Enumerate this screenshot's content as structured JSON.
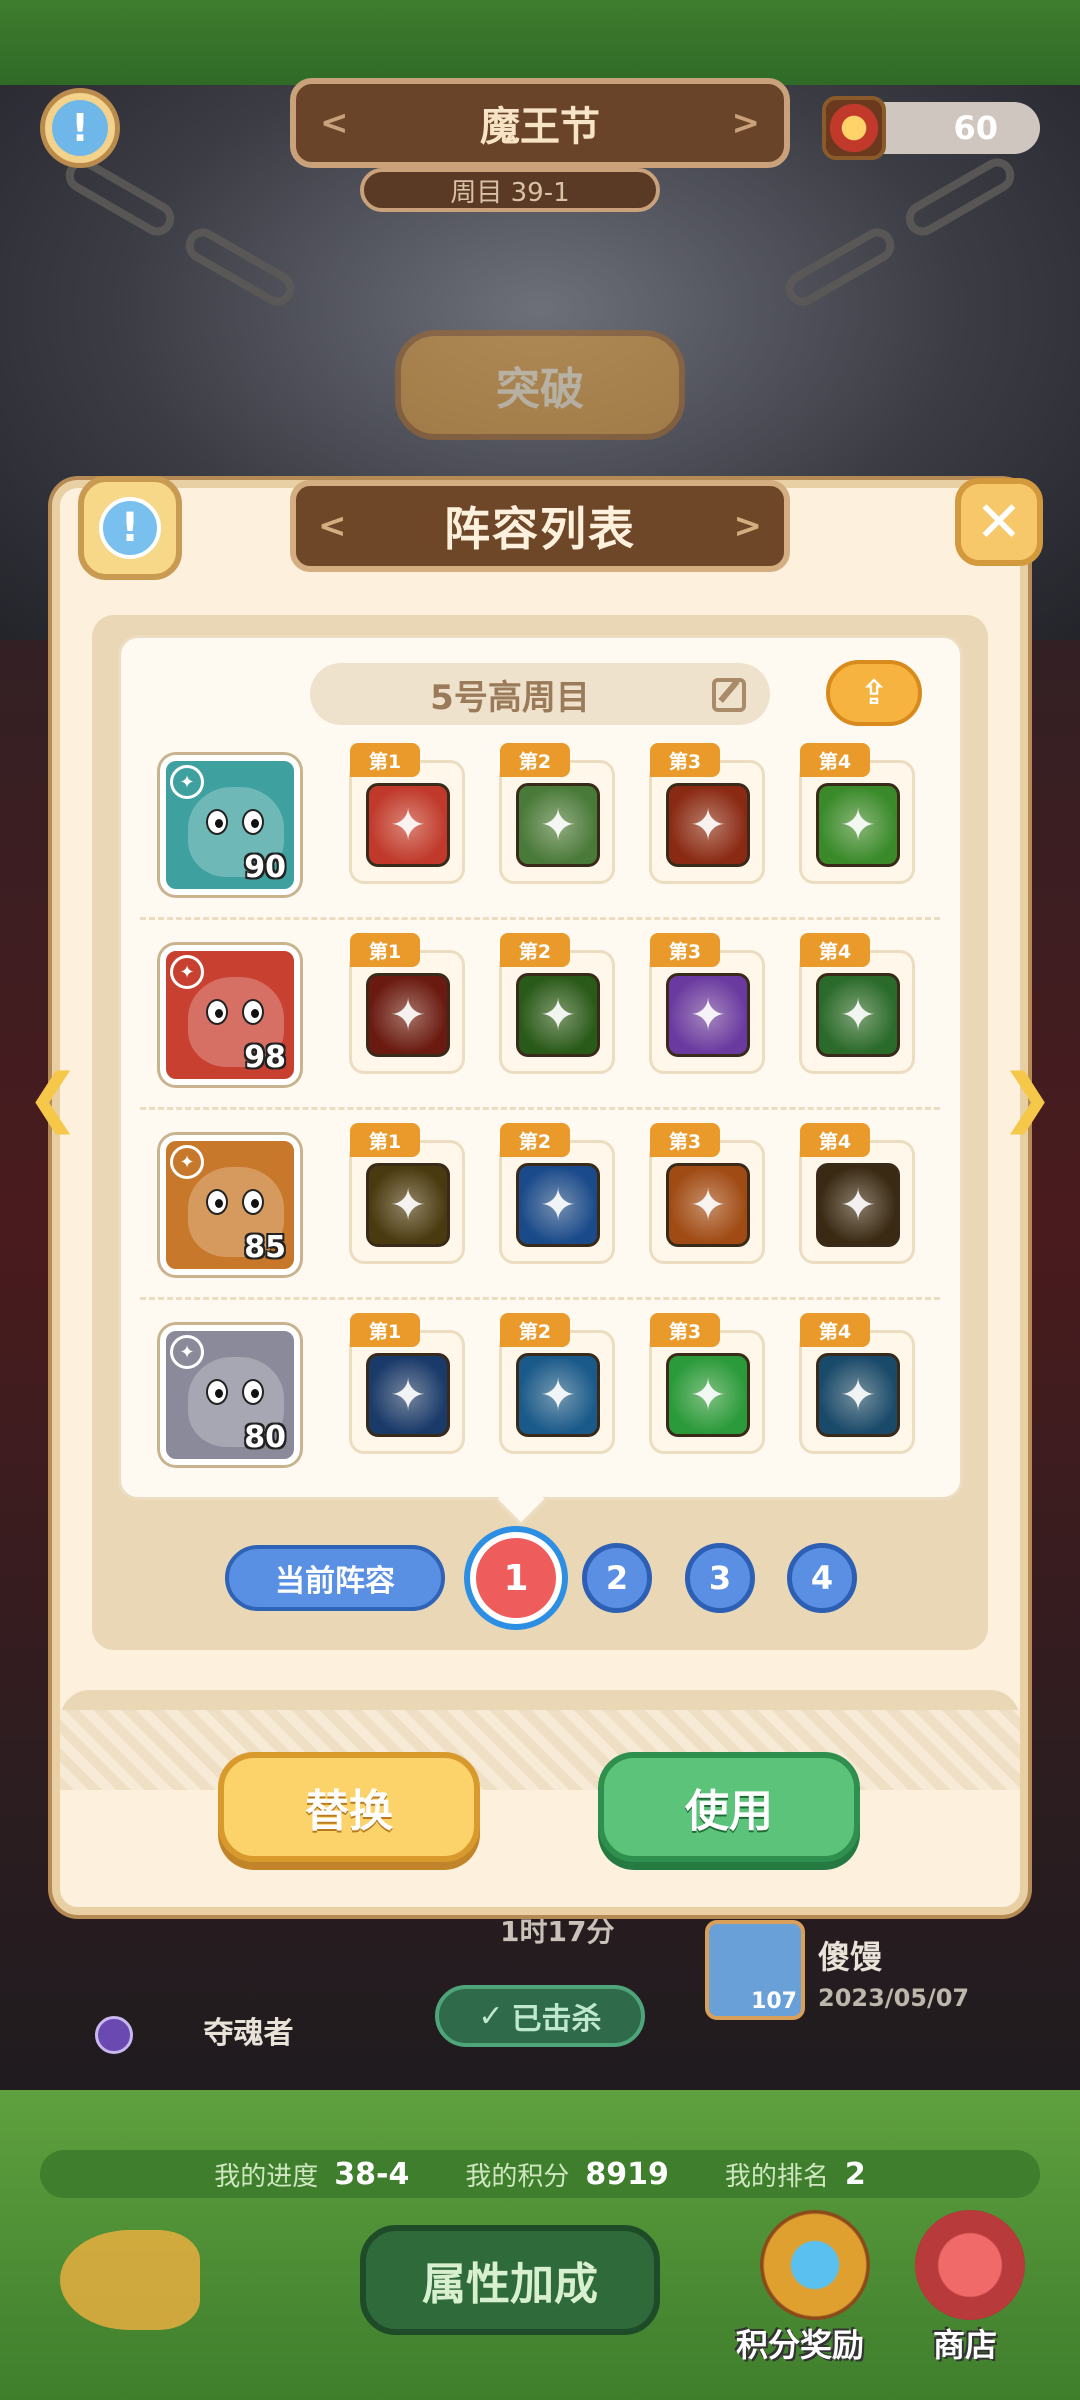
{
  "top_bar": {
    "event_title": "魔王节",
    "round_label": "周目 39-1",
    "currency_value": "60",
    "breakthrough_label": "突破"
  },
  "modal": {
    "title": "阵容列表",
    "lineup_name": "5号高周目",
    "rows": [
      {
        "hero_level": "90",
        "hero_color": "#3fa0a0",
        "skills": [
          {
            "tag": "第1",
            "color": "#c0392b",
            "icon": "axe-icon"
          },
          {
            "tag": "第2",
            "color": "#4a7a3a",
            "icon": "arrows-icon"
          },
          {
            "tag": "第3",
            "color": "#8a2a14",
            "icon": "demon-face-icon"
          },
          {
            "tag": "第4",
            "color": "#3a8a2a",
            "icon": "shield-star-icon"
          }
        ]
      },
      {
        "hero_level": "98",
        "hero_color": "#c84030",
        "skills": [
          {
            "tag": "第1",
            "color": "#6a1a10",
            "icon": "fire-shadow-icon"
          },
          {
            "tag": "第2",
            "color": "#2a5a1a",
            "icon": "goblin-icon"
          },
          {
            "tag": "第3",
            "color": "#6a3aa0",
            "icon": "ghost-icon"
          },
          {
            "tag": "第4",
            "color": "#2a6a2a",
            "icon": "slash-icon"
          }
        ]
      },
      {
        "hero_level": "85",
        "hero_color": "#c8782a",
        "skills": [
          {
            "tag": "第1",
            "color": "#4a3a10",
            "icon": "stars-icon"
          },
          {
            "tag": "第2",
            "color": "#1a4a8a",
            "icon": "water-icon"
          },
          {
            "tag": "第3",
            "color": "#a04a14",
            "icon": "spear-icon"
          },
          {
            "tag": "第4",
            "color": "#3a2a14",
            "icon": "target-icon"
          }
        ]
      },
      {
        "hero_level": "80",
        "hero_color": "#8a8a9a",
        "skills": [
          {
            "tag": "第1",
            "color": "#1a3a6a",
            "icon": "ice-sword-icon"
          },
          {
            "tag": "第2",
            "color": "#1a5a8a",
            "icon": "frost-mace-icon"
          },
          {
            "tag": "第3",
            "color": "#2a9a3a",
            "icon": "cloud-icon"
          },
          {
            "tag": "第4",
            "color": "#1a4a6a",
            "icon": "red-mask-icon"
          }
        ]
      }
    ],
    "current_lineup_label": "当前阵容",
    "lineup_numbers": [
      "1",
      "2",
      "3",
      "4"
    ],
    "active_lineup": "1",
    "replace_label": "替换",
    "use_label": "使用"
  },
  "background": {
    "time_fragment": "1时17分",
    "soul_stealer_label": "夺魂者",
    "killed_label": "已击杀",
    "player_name": "傻馒",
    "player_level": "107",
    "player_date": "2023/05/07"
  },
  "bottom_bar": {
    "progress_label": "我的进度",
    "progress_value": "38-4",
    "score_label": "我的积分",
    "score_value": "8919",
    "rank_label": "我的排名",
    "rank_value": "2",
    "attribute_bonus_label": "属性加成",
    "score_reward_label": "积分奖励",
    "shop_label": "商店"
  },
  "colors": {
    "accent_orange": "#e99a2a",
    "use_green": "#5cc47a",
    "replace_yellow": "#fbd36a",
    "lineup_blue": "#5a8fe3",
    "active_red": "#ef5c5c"
  }
}
